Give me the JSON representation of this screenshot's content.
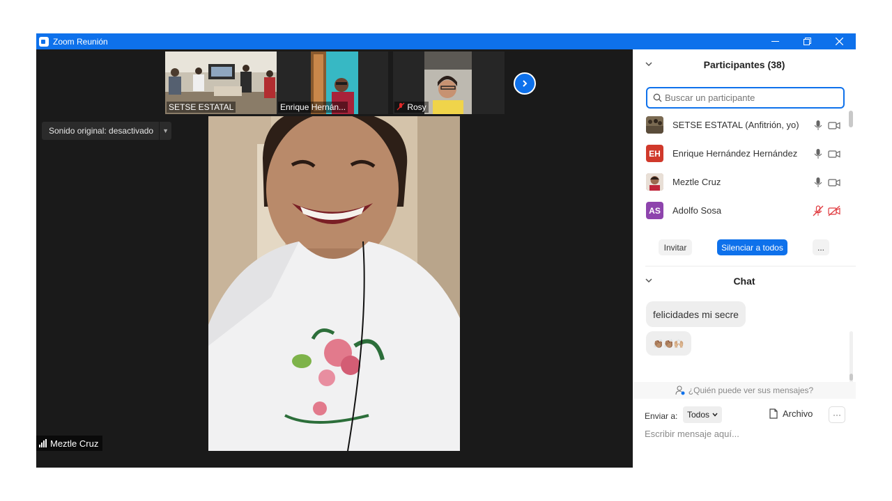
{
  "window": {
    "title": "Zoom Reunión",
    "accent": "#0e71eb"
  },
  "stage": {
    "sound_toggle_label": "Sonido original: desactivado",
    "active_speaker": "Meztle Cruz",
    "thumbnails": [
      {
        "name": "SETSE ESTATAL",
        "muted": false
      },
      {
        "name": "Enrique Hernán...",
        "muted": false
      },
      {
        "name": "Rosy",
        "muted": true
      }
    ]
  },
  "participants": {
    "header": "Participantes (38)",
    "search_placeholder": "Buscar un participante",
    "list": [
      {
        "name": "SETSE ESTATAL (Anfitrión, yo)",
        "initials": "",
        "avatar_color": "#6b5b44",
        "mic": "on",
        "cam": "on"
      },
      {
        "name": "Enrique Hernández Hernández",
        "initials": "EH",
        "avatar_color": "#d0392b",
        "mic": "on",
        "cam": "on"
      },
      {
        "name": "Meztle Cruz",
        "initials": "",
        "avatar_color": "#b9897a",
        "mic": "on",
        "cam": "on"
      },
      {
        "name": "Adolfo Sosa",
        "initials": "AS",
        "avatar_color": "#8e44ad",
        "mic": "off",
        "cam": "off"
      }
    ],
    "invite_label": "Invitar",
    "mute_all_label": "Silenciar a todos",
    "more_label": "..."
  },
  "chat": {
    "header": "Chat",
    "messages": [
      {
        "text": "felicidades mi secre"
      },
      {
        "text": "👏🏽👏🏽🙌🏼"
      }
    ],
    "who_can_see": "¿Quién puede ver sus mensajes?",
    "send_to_label": "Enviar a:",
    "send_to_value": "Todos",
    "file_label": "Archivo",
    "more_label": "···",
    "input_placeholder": "Escribir mensaje aquí..."
  }
}
